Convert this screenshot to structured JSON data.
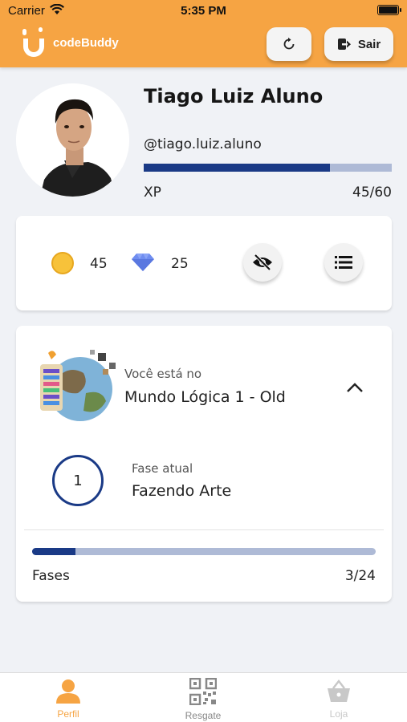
{
  "status_bar": {
    "carrier": "Carrier",
    "time": "5:35 PM"
  },
  "header": {
    "brand": "codeBuddy",
    "refresh_icon": "refresh-icon",
    "logout_label": "Sair",
    "logout_icon": "logout-icon",
    "accent_color": "#f6a443"
  },
  "profile": {
    "name": "Tiago Luiz Aluno",
    "username": "@tiago.luiz.aluno",
    "xp_label": "XP",
    "xp_value": "45/60",
    "xp_progress": 0.75
  },
  "stats": {
    "coins": "45",
    "gems": "25",
    "coin_icon": "coin-icon",
    "gem_icon": "diamond-icon",
    "hide_icon": "eye-off-icon",
    "list_icon": "list-icon"
  },
  "world": {
    "subtitle": "Você está no",
    "name": "Mundo Lógica 1 - Old",
    "phase_number": "1",
    "phase_subtitle": "Fase atual",
    "phase_name": "Fazendo Arte",
    "phases_label": "Fases",
    "phases_value": "3/24",
    "phases_progress": 0.125
  },
  "tabs": [
    {
      "label": "Perfil",
      "icon": "person-icon",
      "active": true
    },
    {
      "label": "Resgate",
      "icon": "qr-code-icon",
      "active": false
    },
    {
      "label": "Loja",
      "icon": "basket-icon",
      "active": false
    }
  ],
  "colors": {
    "primary_dark": "#1a3a86",
    "progress_track": "#aebad6"
  }
}
